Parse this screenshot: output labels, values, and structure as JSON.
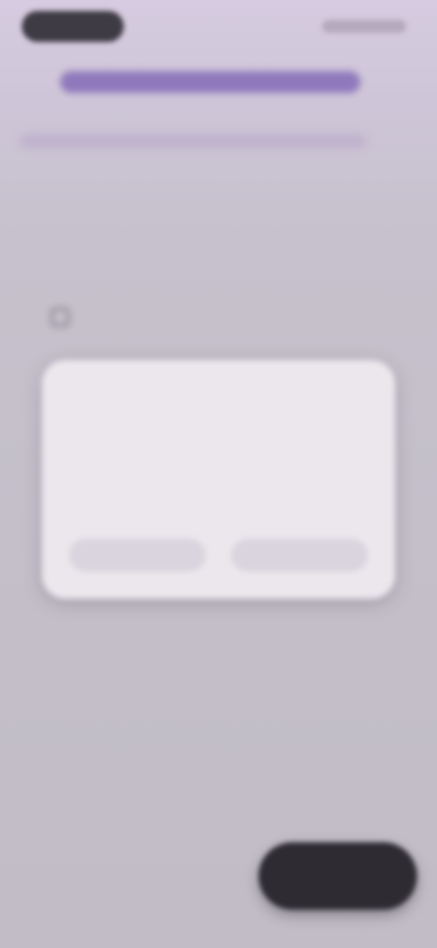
{
  "header": {
    "back_label": "",
    "right_label": ""
  },
  "content": {
    "banner_text": "",
    "subline_text": "",
    "heading": "",
    "section_label": ""
  },
  "dialog": {
    "title": "",
    "body": "",
    "secondary_label": "",
    "primary_label": ""
  },
  "fab": {
    "label": ""
  },
  "colors": {
    "accent": "#8f79bc",
    "dialog_bg": "#ebe7ed",
    "fab_bg": "#2e2b32"
  }
}
